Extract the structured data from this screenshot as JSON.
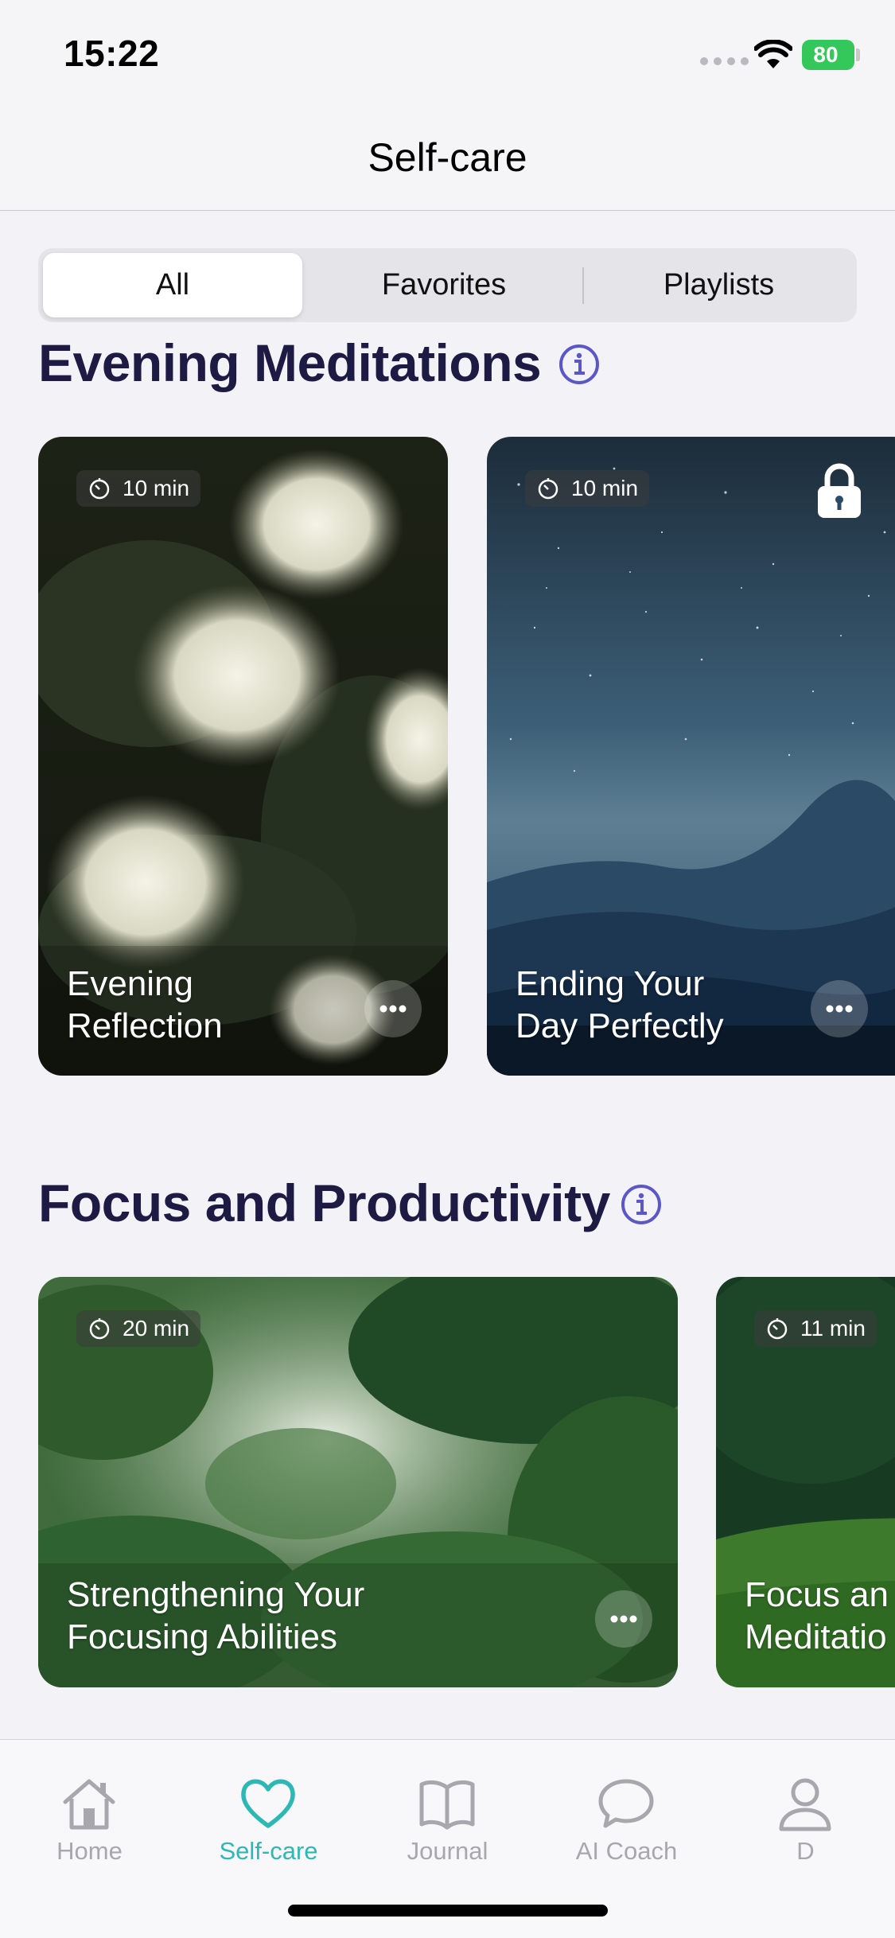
{
  "status_bar": {
    "time": "15:22",
    "battery": "80"
  },
  "header": {
    "title": "Self-care"
  },
  "segments": [
    {
      "label": "All",
      "selected": true
    },
    {
      "label": "Favorites",
      "selected": false
    },
    {
      "label": "Playlists",
      "selected": false
    }
  ],
  "sections": [
    {
      "title": "Evening Meditations",
      "cards": [
        {
          "duration": "10 min",
          "title": "Evening\nReflection",
          "locked": false
        },
        {
          "duration": "10 min",
          "title": "Ending Your\nDay Perfectly",
          "locked": true
        }
      ]
    },
    {
      "title": "Focus and Productivity",
      "cards": [
        {
          "duration": "20 min",
          "title": "Strengthening Your\nFocusing Abilities",
          "locked": false
        },
        {
          "duration": "11 min",
          "title": "Focus an\nMeditatio",
          "locked": false
        }
      ]
    }
  ],
  "tab_bar": {
    "items": [
      {
        "label": "Home",
        "icon": "home-icon",
        "active": false
      },
      {
        "label": "Self-care",
        "icon": "heart-icon",
        "active": true
      },
      {
        "label": "Journal",
        "icon": "book-icon",
        "active": false
      },
      {
        "label": "AI Coach",
        "icon": "chat-bubble-icon",
        "active": false
      },
      {
        "label": "D",
        "icon": "person-icon",
        "active": false
      }
    ]
  },
  "colors": {
    "accent": "#2fb8b3",
    "heading": "#1d1a44",
    "info_icon": "#5b57c8",
    "battery": "#34c759"
  }
}
